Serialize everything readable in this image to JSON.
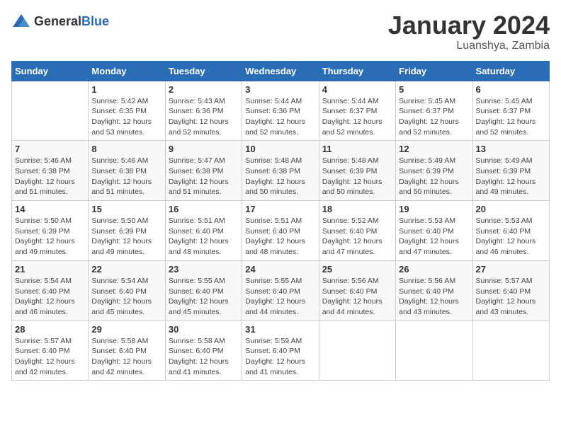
{
  "header": {
    "logo": {
      "general": "General",
      "blue": "Blue"
    },
    "title": "January 2024",
    "subtitle": "Luanshya, Zambia"
  },
  "days_of_week": [
    "Sunday",
    "Monday",
    "Tuesday",
    "Wednesday",
    "Thursday",
    "Friday",
    "Saturday"
  ],
  "weeks": [
    [
      {
        "day": "",
        "info": ""
      },
      {
        "day": "1",
        "info": "Sunrise: 5:42 AM\nSunset: 6:35 PM\nDaylight: 12 hours\nand 53 minutes."
      },
      {
        "day": "2",
        "info": "Sunrise: 5:43 AM\nSunset: 6:36 PM\nDaylight: 12 hours\nand 52 minutes."
      },
      {
        "day": "3",
        "info": "Sunrise: 5:44 AM\nSunset: 6:36 PM\nDaylight: 12 hours\nand 52 minutes."
      },
      {
        "day": "4",
        "info": "Sunrise: 5:44 AM\nSunset: 6:37 PM\nDaylight: 12 hours\nand 52 minutes."
      },
      {
        "day": "5",
        "info": "Sunrise: 5:45 AM\nSunset: 6:37 PM\nDaylight: 12 hours\nand 52 minutes."
      },
      {
        "day": "6",
        "info": "Sunrise: 5:45 AM\nSunset: 6:37 PM\nDaylight: 12 hours\nand 52 minutes."
      }
    ],
    [
      {
        "day": "7",
        "info": "Sunrise: 5:46 AM\nSunset: 6:38 PM\nDaylight: 12 hours\nand 51 minutes."
      },
      {
        "day": "8",
        "info": "Sunrise: 5:46 AM\nSunset: 6:38 PM\nDaylight: 12 hours\nand 51 minutes."
      },
      {
        "day": "9",
        "info": "Sunrise: 5:47 AM\nSunset: 6:38 PM\nDaylight: 12 hours\nand 51 minutes."
      },
      {
        "day": "10",
        "info": "Sunrise: 5:48 AM\nSunset: 6:38 PM\nDaylight: 12 hours\nand 50 minutes."
      },
      {
        "day": "11",
        "info": "Sunrise: 5:48 AM\nSunset: 6:39 PM\nDaylight: 12 hours\nand 50 minutes."
      },
      {
        "day": "12",
        "info": "Sunrise: 5:49 AM\nSunset: 6:39 PM\nDaylight: 12 hours\nand 50 minutes."
      },
      {
        "day": "13",
        "info": "Sunrise: 5:49 AM\nSunset: 6:39 PM\nDaylight: 12 hours\nand 49 minutes."
      }
    ],
    [
      {
        "day": "14",
        "info": "Sunrise: 5:50 AM\nSunset: 6:39 PM\nDaylight: 12 hours\nand 49 minutes."
      },
      {
        "day": "15",
        "info": "Sunrise: 5:50 AM\nSunset: 6:39 PM\nDaylight: 12 hours\nand 49 minutes."
      },
      {
        "day": "16",
        "info": "Sunrise: 5:51 AM\nSunset: 6:40 PM\nDaylight: 12 hours\nand 48 minutes."
      },
      {
        "day": "17",
        "info": "Sunrise: 5:51 AM\nSunset: 6:40 PM\nDaylight: 12 hours\nand 48 minutes."
      },
      {
        "day": "18",
        "info": "Sunrise: 5:52 AM\nSunset: 6:40 PM\nDaylight: 12 hours\nand 47 minutes."
      },
      {
        "day": "19",
        "info": "Sunrise: 5:53 AM\nSunset: 6:40 PM\nDaylight: 12 hours\nand 47 minutes."
      },
      {
        "day": "20",
        "info": "Sunrise: 5:53 AM\nSunset: 6:40 PM\nDaylight: 12 hours\nand 46 minutes."
      }
    ],
    [
      {
        "day": "21",
        "info": "Sunrise: 5:54 AM\nSunset: 6:40 PM\nDaylight: 12 hours\nand 46 minutes."
      },
      {
        "day": "22",
        "info": "Sunrise: 5:54 AM\nSunset: 6:40 PM\nDaylight: 12 hours\nand 45 minutes."
      },
      {
        "day": "23",
        "info": "Sunrise: 5:55 AM\nSunset: 6:40 PM\nDaylight: 12 hours\nand 45 minutes."
      },
      {
        "day": "24",
        "info": "Sunrise: 5:55 AM\nSunset: 6:40 PM\nDaylight: 12 hours\nand 44 minutes."
      },
      {
        "day": "25",
        "info": "Sunrise: 5:56 AM\nSunset: 6:40 PM\nDaylight: 12 hours\nand 44 minutes."
      },
      {
        "day": "26",
        "info": "Sunrise: 5:56 AM\nSunset: 6:40 PM\nDaylight: 12 hours\nand 43 minutes."
      },
      {
        "day": "27",
        "info": "Sunrise: 5:57 AM\nSunset: 6:40 PM\nDaylight: 12 hours\nand 43 minutes."
      }
    ],
    [
      {
        "day": "28",
        "info": "Sunrise: 5:57 AM\nSunset: 6:40 PM\nDaylight: 12 hours\nand 42 minutes."
      },
      {
        "day": "29",
        "info": "Sunrise: 5:58 AM\nSunset: 6:40 PM\nDaylight: 12 hours\nand 42 minutes."
      },
      {
        "day": "30",
        "info": "Sunrise: 5:58 AM\nSunset: 6:40 PM\nDaylight: 12 hours\nand 41 minutes."
      },
      {
        "day": "31",
        "info": "Sunrise: 5:59 AM\nSunset: 6:40 PM\nDaylight: 12 hours\nand 41 minutes."
      },
      {
        "day": "",
        "info": ""
      },
      {
        "day": "",
        "info": ""
      },
      {
        "day": "",
        "info": ""
      }
    ]
  ]
}
